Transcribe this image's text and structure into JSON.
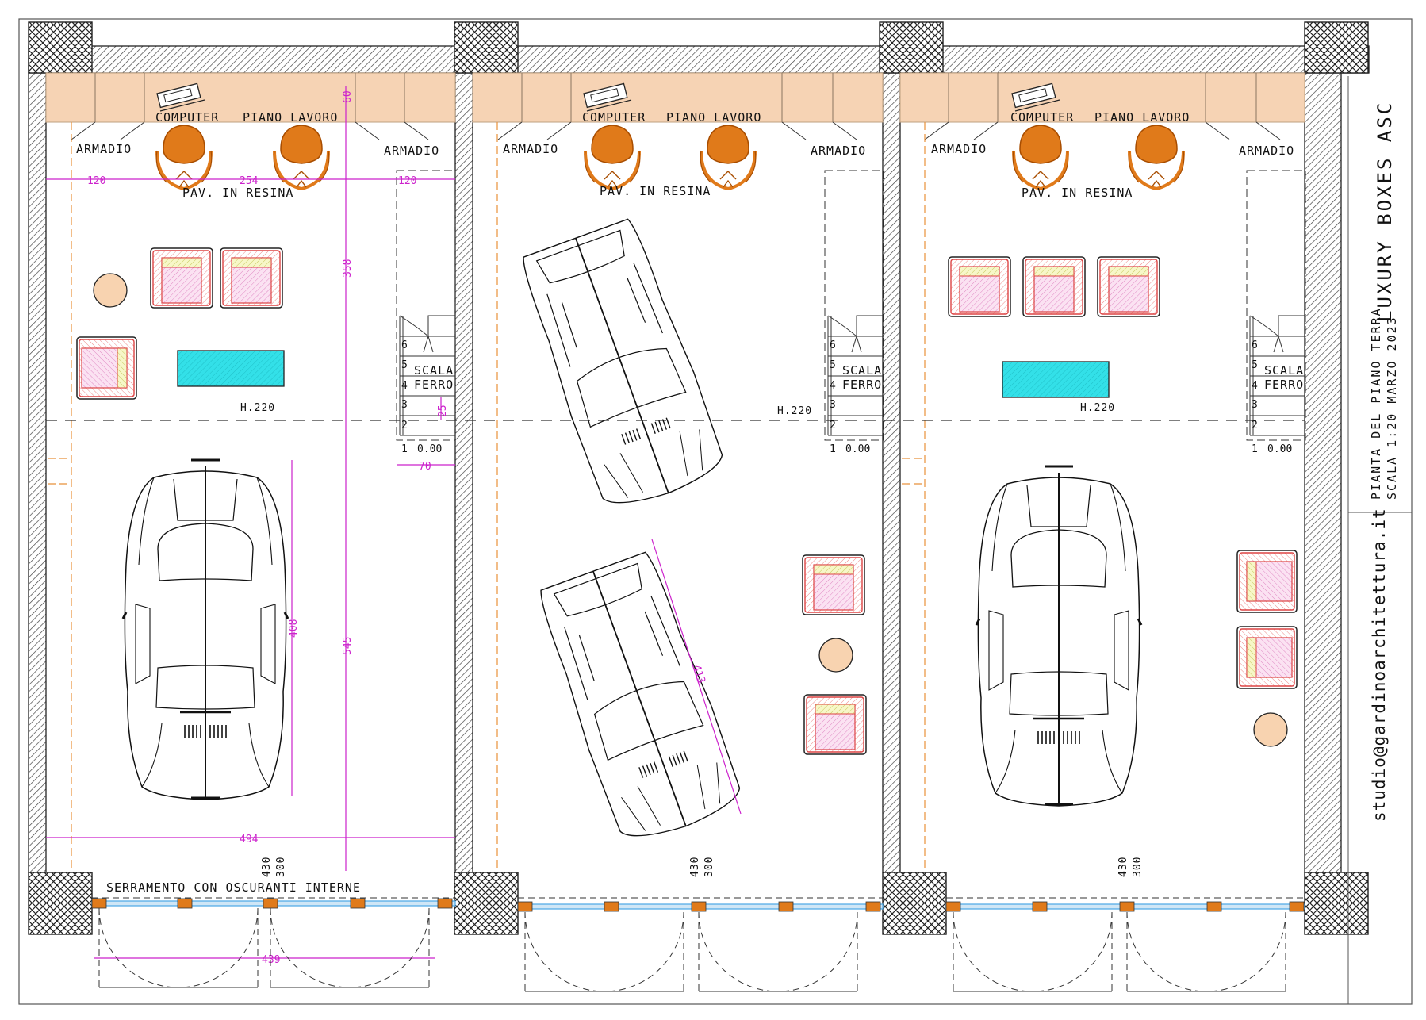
{
  "title_block": {
    "project": "LUXURY BOXES ASC",
    "sheet_line1": "PIANTA DEL PIANO TERRA",
    "sheet_line2": "SCALA 1:20    MARZO 2023",
    "contact": "studio@gardinoarchitettura.it"
  },
  "labels": {
    "computer": "COMPUTER",
    "piano_lavoro": "PIANO LAVORO",
    "armadio": "ARMADIO",
    "pavimento": "PAV. IN RESINA",
    "height": "H.220",
    "scala": "SCALA",
    "ferro": "FERRO",
    "serramento": "SERRAMENTO CON OSCURANTI INTERNE",
    "door_dim_a": "430",
    "door_dim_b": "300"
  },
  "dimensions": {
    "d120": "120",
    "d254": "254",
    "d60": "60",
    "d358": "358",
    "d545": "545",
    "d408": "408",
    "d494": "494",
    "d439": "439",
    "d25": "25",
    "d70": "70",
    "d413": "413"
  },
  "stair_steps": [
    "6",
    "5",
    "4",
    "3",
    "2",
    "1"
  ],
  "stair_level": "0.00",
  "colors": {
    "wall_hatch": "#555555",
    "counter": "#f6d3b4",
    "chair": "#e07a1a",
    "table": "#33e0e8",
    "dimension": "#cc22cc",
    "ottoman": "#f8d3b0",
    "glass": "#4aa6e6",
    "guide_line": "#e8913a"
  },
  "icons": [
    "computer-icon",
    "office-chair-icon",
    "armchair-icon",
    "car-icon",
    "stair-icon",
    "door-swing-icon"
  ]
}
